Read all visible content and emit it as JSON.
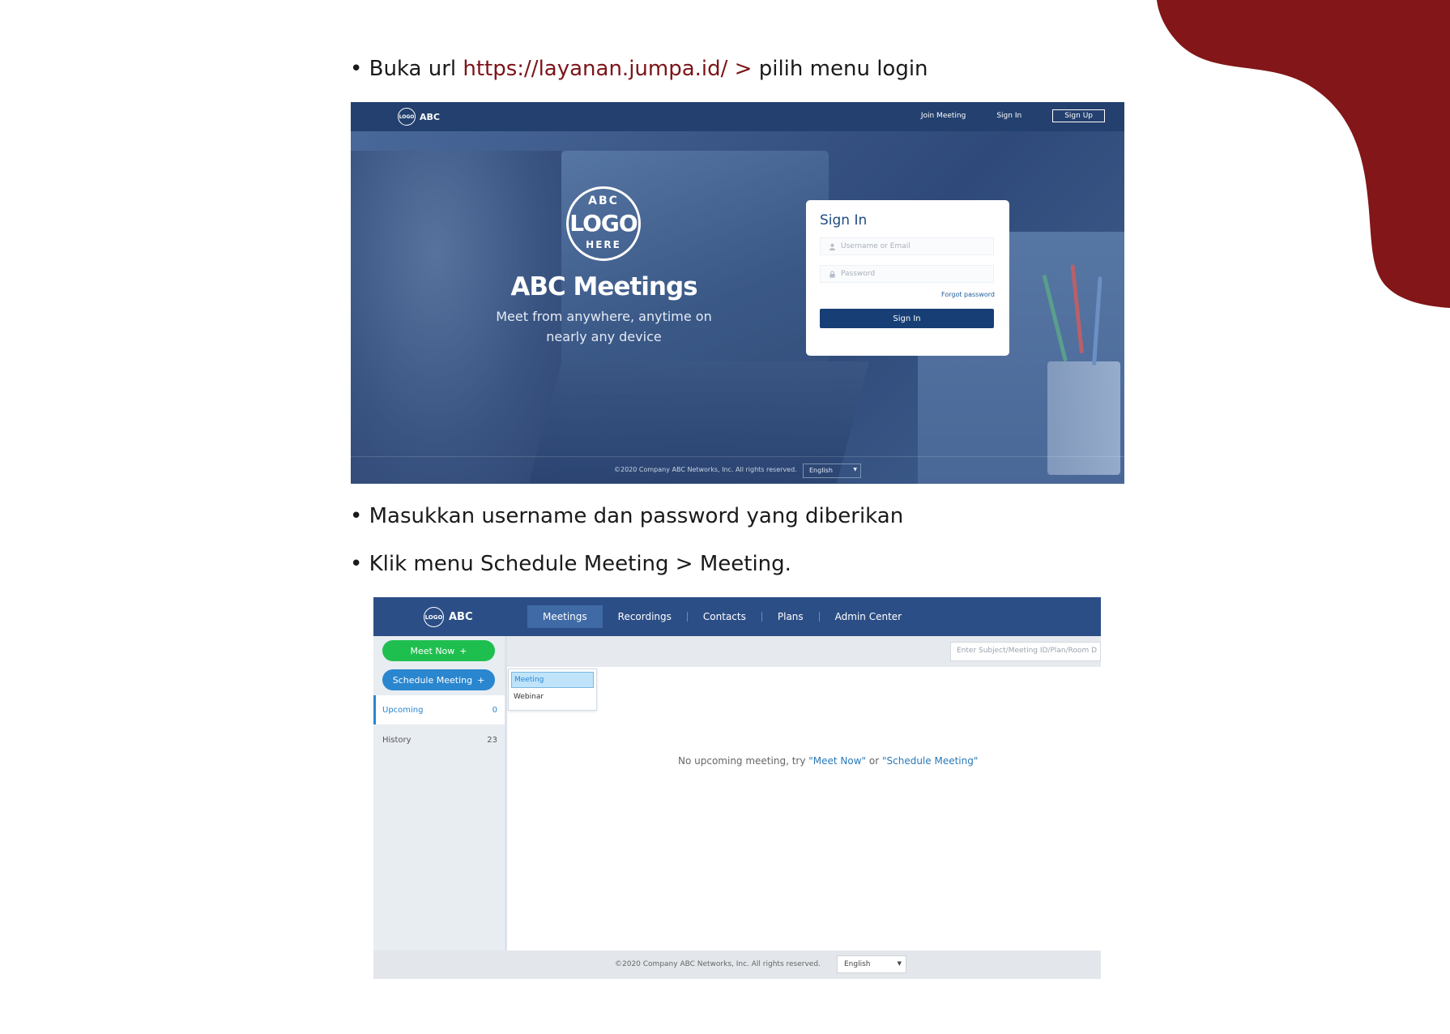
{
  "colors": {
    "accent": "#7b1418",
    "login_topbar": "#23406e",
    "app_topbar": "#2c4e86",
    "meet_now": "#1fbf4f",
    "schedule": "#2a86cf"
  },
  "instructions": {
    "step1_prefix": "• Buka url ",
    "step1_link": "https://layanan.jumpa.id/ >",
    "step1_suffix": " pilih menu login",
    "step2": "• Masukkan username dan password yang diberikan",
    "step3": "• Klik menu  Schedule Meeting > Meeting."
  },
  "login_screen": {
    "brand": "ABC",
    "brand_logo_text": "LOGO",
    "nav": {
      "join": "Join Meeting",
      "signin": "Sign In",
      "signup": "Sign Up"
    },
    "hero_logo": {
      "top": "ABC",
      "main": "LOGO",
      "bottom": "HERE"
    },
    "hero_title": "ABC Meetings",
    "hero_subtitle": "Meet from anywhere, anytime on nearly any device",
    "card": {
      "title": "Sign In",
      "username_placeholder": "Username or Email",
      "password_placeholder": "Password",
      "forgot": "Forgot password",
      "button": "Sign In"
    },
    "footer": {
      "copyright": "©2020 Company ABC Networks, Inc. All rights reserved.",
      "language": "English"
    }
  },
  "meetings_screen": {
    "brand": "ABC",
    "brand_logo_text": "LOGO",
    "tabs": [
      "Meetings",
      "Recordings",
      "Contacts",
      "Plans",
      "Admin Center"
    ],
    "search_placeholder": "Enter Subject/Meeting ID/Plan/Room D",
    "meet_now": "Meet Now",
    "schedule_meeting": "Schedule Meeting",
    "plus": "+",
    "sidebar": [
      {
        "label": "Upcoming",
        "count": "0"
      },
      {
        "label": "History",
        "count": "23"
      }
    ],
    "dropdown": [
      "Meeting",
      "Webinar"
    ],
    "empty": {
      "prefix": "No upcoming meeting, try ",
      "meet_now_link": "\"Meet Now\"",
      "or": " or ",
      "schedule_link": "\"Schedule Meeting\""
    },
    "footer": {
      "copyright": "©2020 Company ABC Networks, Inc. All rights reserved.",
      "language": "English"
    }
  }
}
